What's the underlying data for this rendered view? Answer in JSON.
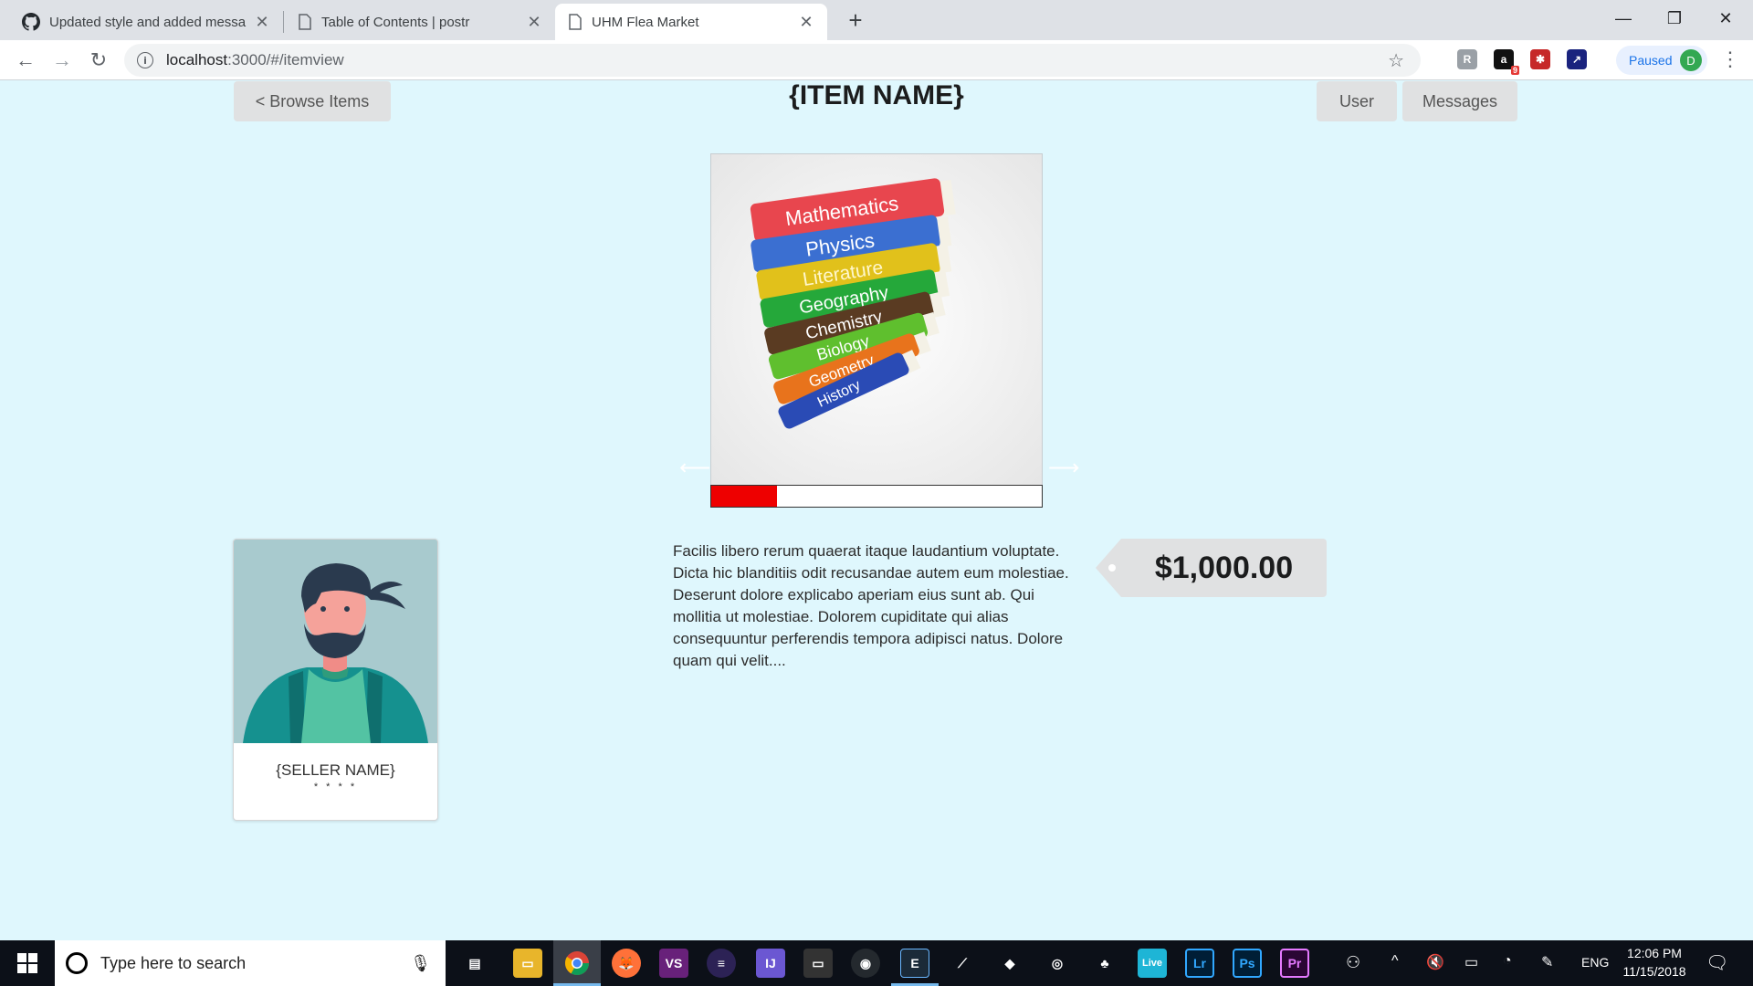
{
  "browser": {
    "tabs": [
      {
        "title": "Updated style and added messa",
        "icon": "github-icon"
      },
      {
        "title": "Table of Contents | postr",
        "icon": "page-icon"
      },
      {
        "title": "UHM Flea Market",
        "icon": "page-icon",
        "active": true
      }
    ],
    "url_host": "localhost",
    "url_path": ":3000/#/itemview",
    "profile_status": "Paused",
    "profile_initial": "D",
    "extension_badge": "9"
  },
  "page": {
    "browse_button": "< Browse Items",
    "title": "{ITEM NAME}",
    "user_button": "User",
    "messages_button": "Messages",
    "carousel": {
      "image": "stack-of-textbooks",
      "book_labels": [
        "Mathematics",
        "Physics",
        "Literature",
        "Geography",
        "Chemistry",
        "Biology",
        "Geometry",
        "History"
      ],
      "progress": 0.2,
      "progress_color": "#ee0000"
    },
    "seller": {
      "name": "{SELLER NAME}",
      "rating": "* * * *"
    },
    "description": "Facilis libero rerum quaerat itaque laudantium voluptate. Dicta hic blanditiis odit recusandae autem eum molestiae. Deserunt dolore explicabo aperiam eius sunt ab. Qui mollitia ut molestiae. Dolorem cupiditate qui alias consequuntur perferendis tempora adipisci natus. Dolore quam qui velit....",
    "price": "$1,000.00",
    "background_color": "#dff7fd"
  },
  "taskbar": {
    "search_placeholder": "Type here to search",
    "language": "ENG",
    "time": "12:06 PM",
    "date": "11/15/2018",
    "live_label": "Live",
    "lr_label": "Lr",
    "ps_label": "Ps",
    "pr_label": "Pr"
  }
}
